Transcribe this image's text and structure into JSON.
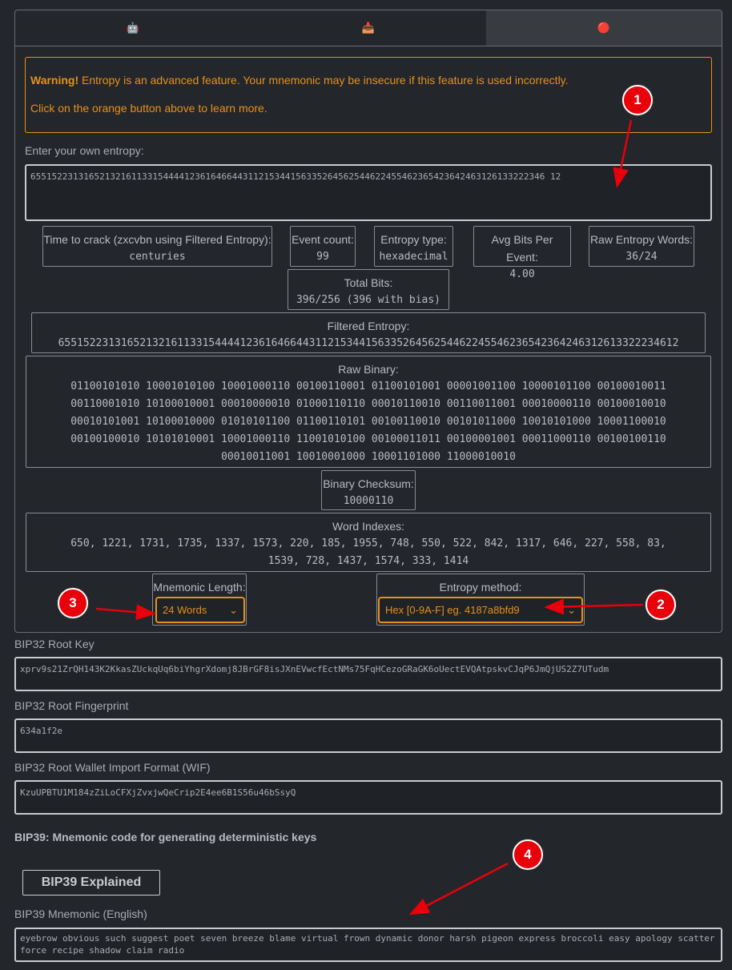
{
  "tabs": [
    {
      "icon": "robot-icon",
      "label": "🤖"
    },
    {
      "icon": "download-box-icon",
      "label": "📥"
    },
    {
      "icon": "gem-icon",
      "label": "🔴"
    }
  ],
  "warning": {
    "bold": "Warning!",
    "text": " Entropy is an advanced feature. Your mnemonic may be insecure if this feature is used incorrectly.",
    "line2": "Click on the orange button above to learn more."
  },
  "entropy": {
    "label": "Enter your own entropy:",
    "value": "6551522313165213216113315444412361646644311215344156335264562544622455462365423642463126133222346 12"
  },
  "stats": {
    "time_to_crack": {
      "label": "Time to crack (zxcvbn using Filtered Entropy):",
      "value": "centuries"
    },
    "event_count": {
      "label": "Event count:",
      "value": "99"
    },
    "entropy_type": {
      "label": "Entropy type:",
      "value": "hexadecimal"
    },
    "avg_bits": {
      "label": "Avg Bits Per Event:",
      "value": "4.00"
    },
    "raw_words": {
      "label": "Raw Entropy Words:",
      "value": "36/24"
    },
    "total_bits": {
      "label": "Total Bits:",
      "value": "396/256 (396 with bias)"
    },
    "filtered": {
      "label": "Filtered Entropy:",
      "value": "655152231316521321611331544441236164664431121534415633526456254462245546236542364246312613322234612"
    },
    "raw_binary": {
      "label": "Raw Binary:",
      "lines": [
        "01100101010 10001010100 10001000110 00100110001 01100101001 00001001100 10000101100 00100010011",
        "00110001010 10100010001 00010000010 01000110110 00010110010 00110011001 00010000110 00100010010",
        "00010101001 10100010000 01010101100 01100110101 00100110010 00101011000 10010101000 10001100010",
        "00100100010 10101010001 10001000110 11001010100 00100011011 00100001001 00011000110 00100100110",
        "00010011001 10010001000 10001101000 11000010010"
      ]
    },
    "checksum": {
      "label": "Binary Checksum:",
      "value": "10000110"
    },
    "word_indexes": {
      "label": "Word Indexes:",
      "lines": [
        "650, 1221, 1731, 1735, 1337, 1573, 220, 185, 1955, 748, 550, 522, 842, 1317, 646, 227, 558, 83,",
        "1539, 728, 1437, 1574, 333, 1414"
      ]
    }
  },
  "mnemonic_length": {
    "label": "Mnemonic Length:",
    "selected": "24 Words"
  },
  "entropy_method": {
    "label": "Entropy method:",
    "selected": "Hex [0-9A-F] eg. 4187a8bfd9"
  },
  "bip32": {
    "root_key": {
      "label": "BIP32 Root Key",
      "value": "xprv9s21ZrQH143K2KkasZUckqUq6biYhgrXdomj8JBrGF8isJXnEVwcfEctNMs75FqHCezoGRaGK6oUectEVQAtpskvCJqP6JmQjUS2Z7UTudm"
    },
    "fingerprint": {
      "label": "BIP32 Root Fingerprint",
      "value": "634a1f2e"
    },
    "wif": {
      "label": "BIP32 Root Wallet Import Format (WIF)",
      "value": "KzuUPBTU1M184zZiLoCFXjZvxjwQeCrip2E4ee6B1S56u46bSsyQ"
    }
  },
  "bip39": {
    "heading": "BIP39: Mnemonic code for generating deterministic keys",
    "explained_button": "BIP39 Explained",
    "mnemonic_label": "BIP39 Mnemonic (English)",
    "mnemonic": "eyebrow obvious such suggest poet seven breeze blame virtual frown dynamic donor harsh pigeon express broccoli easy apology scatter force recipe shadow claim radio"
  },
  "annotations": [
    "1",
    "2",
    "3",
    "4"
  ],
  "colors": {
    "accent": "#e8901a",
    "annotation": "#e8000b",
    "background": "#23262b"
  }
}
